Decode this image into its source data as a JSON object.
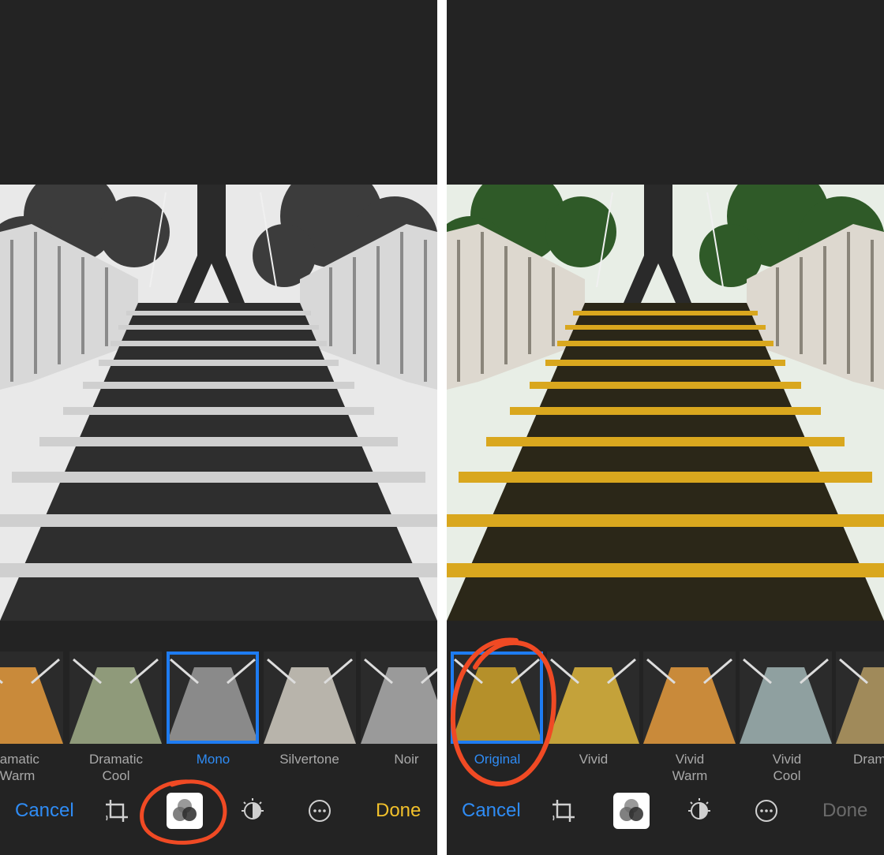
{
  "left_screen": {
    "filters": [
      {
        "label": "ramatic\nWarm",
        "selected": false,
        "tint": "#c98a3a"
      },
      {
        "label": "Dramatic\nCool",
        "selected": false,
        "tint": "#8f9a7a"
      },
      {
        "label": "Mono",
        "selected": true,
        "tint": "#8a8a8a"
      },
      {
        "label": "Silvertone",
        "selected": false,
        "tint": "#b8b4ab"
      },
      {
        "label": "Noir",
        "selected": false,
        "tint": "#9a9a9a"
      }
    ],
    "cancel_label": "Cancel",
    "done_label": "Done",
    "done_enabled": true,
    "photo_mode": "mono"
  },
  "right_screen": {
    "filters": [
      {
        "label": "Original",
        "selected": true,
        "tint": "#b5902a"
      },
      {
        "label": "Vivid",
        "selected": false,
        "tint": "#c4a23a"
      },
      {
        "label": "Vivid\nWarm",
        "selected": false,
        "tint": "#c98a3a"
      },
      {
        "label": "Vivid\nCool",
        "selected": false,
        "tint": "#8fa0a0"
      },
      {
        "label": "Dram",
        "selected": false,
        "tint": "#a08a5a"
      }
    ],
    "cancel_label": "Cancel",
    "done_label": "Done",
    "done_enabled": false,
    "photo_mode": "color"
  },
  "icons": [
    "crop-icon",
    "filters-icon",
    "adjust-dial-icon",
    "more-options-icon"
  ],
  "colors": {
    "accent_blue": "#2f8cf5",
    "done_yellow": "#f2c12b",
    "annotation_red": "#f04a24",
    "background": "#232323"
  }
}
